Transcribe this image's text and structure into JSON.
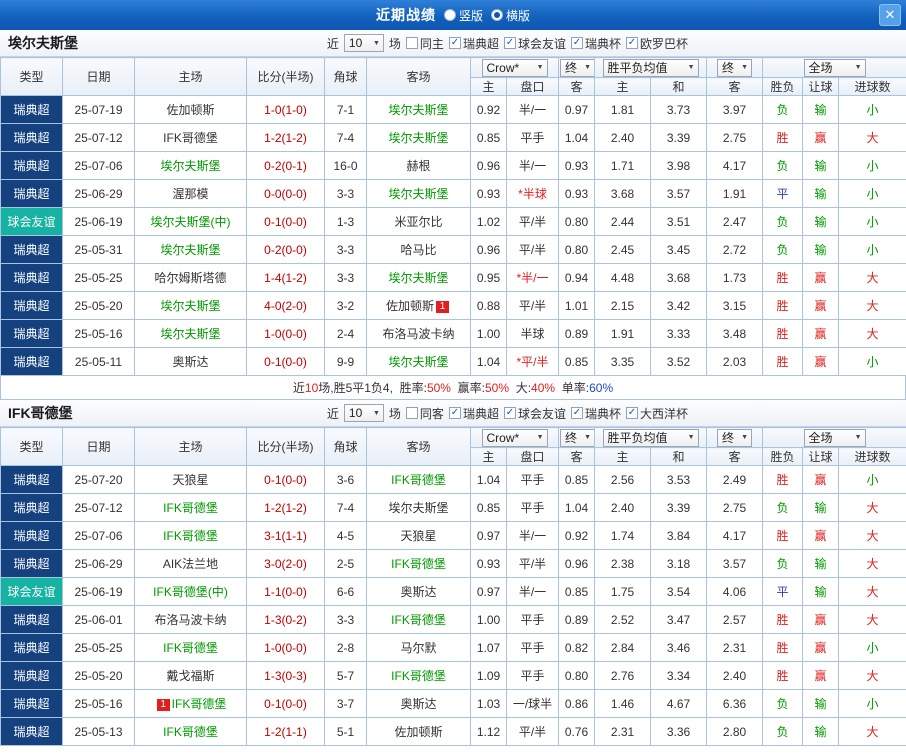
{
  "header": {
    "title": "近期战绩",
    "vertical_label": "竖版",
    "horizontal_label": "横版"
  },
  "icons": {
    "close": "✕",
    "dropdown": "▼",
    "check": "✓"
  },
  "table_columns": {
    "left": [
      "类型",
      "日期",
      "主场",
      "比分(半场)",
      "角球",
      "客场"
    ],
    "sub": [
      "主",
      "盘口",
      "客",
      "主",
      "和",
      "客",
      "胜负",
      "让球",
      "进球数"
    ],
    "bookmaker": "Crow*",
    "final": "终",
    "avg": "胜平负均值",
    "final2": "终",
    "scope": "全场"
  },
  "league_colors": {
    "瑞典超": "#15417e",
    "球会友谊": "#16b2a2"
  },
  "result_colors": {
    "胜": "#e02020",
    "平": "#2a3db8",
    "负": "#009900",
    "赢": "#e02020",
    "输": "#009900",
    "大": "#e02020",
    "小": "#009900"
  },
  "palette": {
    "red": "#e02020",
    "blue": "#1f46c8",
    "green": "#009900"
  },
  "sections": [
    {
      "team": "埃尔夫斯堡",
      "filters": {
        "near": "近",
        "count": "10",
        "games": "场",
        "same": {
          "label": "同主",
          "checked": false
        },
        "leagues": [
          {
            "label": "瑞典超",
            "checked": true
          },
          {
            "label": "球会友谊",
            "checked": true
          },
          {
            "label": "瑞典杯",
            "checked": true
          },
          {
            "label": "欧罗巴杯",
            "checked": true
          }
        ]
      },
      "rows": [
        {
          "league": "瑞典超",
          "date": "25-07-19",
          "home": {
            "name": "佐加顿斯"
          },
          "score": "1-0(1-0)",
          "corner": "7-1",
          "away": {
            "name": "埃尔夫斯堡",
            "focal": true
          },
          "ah": [
            "0.92",
            "半/一",
            "0.97"
          ],
          "odds": [
            "1.81",
            "3.73",
            "3.97"
          ],
          "res": [
            "负",
            "输",
            "小"
          ]
        },
        {
          "league": "瑞典超",
          "date": "25-07-12",
          "home": {
            "name": "IFK哥德堡"
          },
          "score": "1-2(1-2)",
          "corner": "7-4",
          "away": {
            "name": "埃尔夫斯堡",
            "focal": true
          },
          "ah": [
            "0.85",
            "平手",
            "1.04"
          ],
          "odds": [
            "2.40",
            "3.39",
            "2.75"
          ],
          "res": [
            "胜",
            "赢",
            "大"
          ]
        },
        {
          "league": "瑞典超",
          "date": "25-07-06",
          "home": {
            "name": "埃尔夫斯堡",
            "focal": true
          },
          "score": "0-2(0-1)",
          "corner": "16-0",
          "away": {
            "name": "赫根"
          },
          "ah": [
            "0.96",
            "半/一",
            "0.93"
          ],
          "odds": [
            "1.71",
            "3.98",
            "4.17"
          ],
          "res": [
            "负",
            "输",
            "小"
          ]
        },
        {
          "league": "瑞典超",
          "date": "25-06-29",
          "home": {
            "name": "渥那模"
          },
          "score": "0-0(0-0)",
          "corner": "3-3",
          "away": {
            "name": "埃尔夫斯堡",
            "focal": true
          },
          "ah": [
            "0.93",
            "*半球",
            "0.93"
          ],
          "odds": [
            "3.68",
            "3.57",
            "1.91"
          ],
          "res": [
            "平",
            "输",
            "小"
          ]
        },
        {
          "league": "球会友谊",
          "date": "25-06-19",
          "home": {
            "name": "埃尔夫斯堡(中)",
            "focal": true
          },
          "score": "0-1(0-0)",
          "corner": "1-3",
          "away": {
            "name": "米亚尔比"
          },
          "ah": [
            "1.02",
            "平/半",
            "0.80"
          ],
          "odds": [
            "2.44",
            "3.51",
            "2.47"
          ],
          "res": [
            "负",
            "输",
            "小"
          ]
        },
        {
          "league": "瑞典超",
          "date": "25-05-31",
          "home": {
            "name": "埃尔夫斯堡",
            "focal": true
          },
          "score": "0-2(0-0)",
          "corner": "3-3",
          "away": {
            "name": "哈马比"
          },
          "ah": [
            "0.96",
            "平/半",
            "0.80"
          ],
          "odds": [
            "2.45",
            "3.45",
            "2.72"
          ],
          "res": [
            "负",
            "输",
            "小"
          ]
        },
        {
          "league": "瑞典超",
          "date": "25-05-25",
          "home": {
            "name": "哈尔姆斯塔德"
          },
          "score": "1-4(1-2)",
          "corner": "3-3",
          "away": {
            "name": "埃尔夫斯堡",
            "focal": true
          },
          "ah": [
            "0.95",
            "*半/一",
            "0.94"
          ],
          "odds": [
            "4.48",
            "3.68",
            "1.73"
          ],
          "res": [
            "胜",
            "赢",
            "大"
          ]
        },
        {
          "league": "瑞典超",
          "date": "25-05-20",
          "home": {
            "name": "埃尔夫斯堡",
            "focal": true
          },
          "score": "4-0(2-0)",
          "corner": "3-2",
          "away": {
            "name": "佐加顿斯",
            "badge_after": "1"
          },
          "ah": [
            "0.88",
            "平/半",
            "1.01"
          ],
          "odds": [
            "2.15",
            "3.42",
            "3.15"
          ],
          "res": [
            "胜",
            "赢",
            "大"
          ]
        },
        {
          "league": "瑞典超",
          "date": "25-05-16",
          "home": {
            "name": "埃尔夫斯堡",
            "focal": true
          },
          "score": "1-0(0-0)",
          "corner": "2-4",
          "away": {
            "name": "布洛马波卡纳"
          },
          "ah": [
            "1.00",
            "半球",
            "0.89"
          ],
          "odds": [
            "1.91",
            "3.33",
            "3.48"
          ],
          "res": [
            "胜",
            "赢",
            "大"
          ]
        },
        {
          "league": "瑞典超",
          "date": "25-05-11",
          "home": {
            "name": "奥斯达"
          },
          "score": "0-1(0-0)",
          "corner": "9-9",
          "away": {
            "name": "埃尔夫斯堡",
            "focal": true
          },
          "ah": [
            "1.04",
            "*平/半",
            "0.85"
          ],
          "odds": [
            "3.35",
            "3.52",
            "2.03"
          ],
          "res": [
            "胜",
            "赢",
            "小"
          ]
        }
      ],
      "summary": [
        {
          "t": "近"
        },
        {
          "t": "10",
          "c": "red"
        },
        {
          "t": "场,胜5平1负4,  "
        },
        {
          "t": "胜率:"
        },
        {
          "t": "50%",
          "c": "red"
        },
        {
          "t": "  赢率:"
        },
        {
          "t": "50%",
          "c": "red"
        },
        {
          "t": "  大:"
        },
        {
          "t": "40%",
          "c": "red"
        },
        {
          "t": "  单率:"
        },
        {
          "t": "60%",
          "c": "blue"
        }
      ]
    },
    {
      "team": "IFK哥德堡",
      "filters": {
        "near": "近",
        "count": "10",
        "games": "场",
        "same": {
          "label": "同客",
          "checked": false
        },
        "leagues": [
          {
            "label": "瑞典超",
            "checked": true
          },
          {
            "label": "球会友谊",
            "checked": true
          },
          {
            "label": "瑞典杯",
            "checked": true
          },
          {
            "label": "大西洋杯",
            "checked": true
          }
        ]
      },
      "rows": [
        {
          "league": "瑞典超",
          "date": "25-07-20",
          "home": {
            "name": "天狼星"
          },
          "score": "0-1(0-0)",
          "corner": "3-6",
          "away": {
            "name": "IFK哥德堡",
            "focal": true
          },
          "ah": [
            "1.04",
            "平手",
            "0.85"
          ],
          "odds": [
            "2.56",
            "3.53",
            "2.49"
          ],
          "res": [
            "胜",
            "赢",
            "小"
          ]
        },
        {
          "league": "瑞典超",
          "date": "25-07-12",
          "home": {
            "name": "IFK哥德堡",
            "focal": true
          },
          "score": "1-2(1-2)",
          "corner": "7-4",
          "away": {
            "name": "埃尔夫斯堡"
          },
          "ah": [
            "0.85",
            "平手",
            "1.04"
          ],
          "odds": [
            "2.40",
            "3.39",
            "2.75"
          ],
          "res": [
            "负",
            "输",
            "大"
          ]
        },
        {
          "league": "瑞典超",
          "date": "25-07-06",
          "home": {
            "name": "IFK哥德堡",
            "focal": true
          },
          "score": "3-1(1-1)",
          "corner": "4-5",
          "away": {
            "name": "天狼星"
          },
          "ah": [
            "0.97",
            "半/一",
            "0.92"
          ],
          "odds": [
            "1.74",
            "3.84",
            "4.17"
          ],
          "res": [
            "胜",
            "赢",
            "大"
          ]
        },
        {
          "league": "瑞典超",
          "date": "25-06-29",
          "home": {
            "name": "AIK法兰地"
          },
          "score": "3-0(2-0)",
          "corner": "2-5",
          "away": {
            "name": "IFK哥德堡",
            "focal": true
          },
          "ah": [
            "0.93",
            "平/半",
            "0.96"
          ],
          "odds": [
            "2.38",
            "3.18",
            "3.57"
          ],
          "res": [
            "负",
            "输",
            "大"
          ]
        },
        {
          "league": "球会友谊",
          "date": "25-06-19",
          "home": {
            "name": "IFK哥德堡(中)",
            "focal": true
          },
          "score": "1-1(0-0)",
          "corner": "6-6",
          "away": {
            "name": "奥斯达"
          },
          "ah": [
            "0.97",
            "半/一",
            "0.85"
          ],
          "odds": [
            "1.75",
            "3.54",
            "4.06"
          ],
          "res": [
            "平",
            "输",
            "大"
          ]
        },
        {
          "league": "瑞典超",
          "date": "25-06-01",
          "home": {
            "name": "布洛马波卡纳"
          },
          "score": "1-3(0-2)",
          "corner": "3-3",
          "away": {
            "name": "IFK哥德堡",
            "focal": true
          },
          "ah": [
            "1.00",
            "平手",
            "0.89"
          ],
          "odds": [
            "2.52",
            "3.47",
            "2.57"
          ],
          "res": [
            "胜",
            "赢",
            "大"
          ]
        },
        {
          "league": "瑞典超",
          "date": "25-05-25",
          "home": {
            "name": "IFK哥德堡",
            "focal": true
          },
          "score": "1-0(0-0)",
          "corner": "2-8",
          "away": {
            "name": "马尔默"
          },
          "ah": [
            "1.07",
            "平手",
            "0.82"
          ],
          "odds": [
            "2.84",
            "3.46",
            "2.31"
          ],
          "res": [
            "胜",
            "赢",
            "小"
          ]
        },
        {
          "league": "瑞典超",
          "date": "25-05-20",
          "home": {
            "name": "戴戈福斯"
          },
          "score": "1-3(0-3)",
          "corner": "5-7",
          "away": {
            "name": "IFK哥德堡",
            "focal": true
          },
          "ah": [
            "1.09",
            "平手",
            "0.80"
          ],
          "odds": [
            "2.76",
            "3.34",
            "2.40"
          ],
          "res": [
            "胜",
            "赢",
            "大"
          ]
        },
        {
          "league": "瑞典超",
          "date": "25-05-16",
          "home": {
            "name": "IFK哥德堡",
            "focal": true,
            "badge_before": "1"
          },
          "score": "0-1(0-0)",
          "corner": "3-7",
          "away": {
            "name": "奥斯达"
          },
          "ah": [
            "1.03",
            "一/球半",
            "0.86"
          ],
          "odds": [
            "1.46",
            "4.67",
            "6.36"
          ],
          "res": [
            "负",
            "输",
            "小"
          ]
        },
        {
          "league": "瑞典超",
          "date": "25-05-13",
          "home": {
            "name": "IFK哥德堡",
            "focal": true
          },
          "score": "1-2(1-1)",
          "corner": "5-1",
          "away": {
            "name": "佐加顿斯"
          },
          "ah": [
            "1.12",
            "平/半",
            "0.76"
          ],
          "odds": [
            "2.31",
            "3.36",
            "2.80"
          ],
          "res": [
            "负",
            "输",
            "大"
          ]
        }
      ],
      "summary": null
    }
  ]
}
